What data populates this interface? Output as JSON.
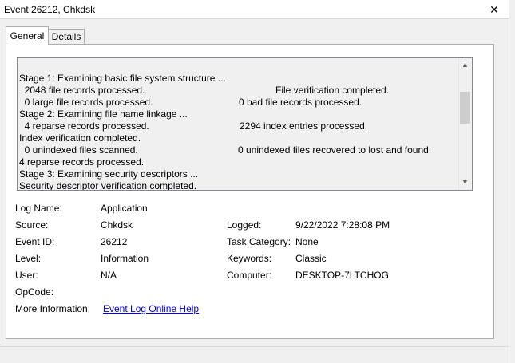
{
  "window": {
    "title": "Event 26212, Chkdsk",
    "close_glyph": "✕"
  },
  "tabs": [
    {
      "label": "General",
      "active": true
    },
    {
      "label": "Details",
      "active": false
    }
  ],
  "description_lines": [
    {
      "left": "Stage 1: Examining basic file system structure ...",
      "right": ""
    },
    {
      "left": "  2048 file records processed.",
      "right": "File verification completed."
    },
    {
      "left": "  0 large file records processed.",
      "right": "0 bad file records processed."
    },
    {
      "left": "Stage 2: Examining file name linkage ...",
      "right": ""
    },
    {
      "left": "  4 reparse records processed.",
      "right": "2294 index entries processed."
    },
    {
      "left": "Index verification completed.",
      "right": ""
    },
    {
      "left": "  0 unindexed files scanned.",
      "right": "0 unindexed files recovered to lost and found."
    },
    {
      "left": "4 reparse records processed.",
      "right": ""
    },
    {
      "left": "Stage 3: Examining security descriptors ...",
      "right": ""
    },
    {
      "left": "Security descriptor verification completed.",
      "right": ""
    }
  ],
  "fields": {
    "log_name": {
      "label": "Log Name:",
      "value": "Application"
    },
    "source": {
      "label": "Source:",
      "value": "Chkdsk"
    },
    "logged": {
      "label": "Logged:",
      "value": "9/22/2022 7:28:08 PM"
    },
    "event_id": {
      "label": "Event ID:",
      "value": "26212"
    },
    "task_category": {
      "label": "Task Category:",
      "value": "None"
    },
    "level": {
      "label": "Level:",
      "value": "Information"
    },
    "keywords": {
      "label": "Keywords:",
      "value": "Classic"
    },
    "user": {
      "label": "User:",
      "value": "N/A"
    },
    "computer": {
      "label": "Computer:",
      "value": "DESKTOP-7LTCHOG"
    },
    "opcode": {
      "label": "OpCode:",
      "value": ""
    },
    "more_info": {
      "label": "More Information:",
      "value": "Event Log Online Help"
    }
  },
  "icons": {
    "scroll_up": "▲",
    "scroll_down": "▼"
  },
  "colors": {
    "link": "#0000ee",
    "panel_bg": "#ffffff",
    "window_bg": "#f0f0f0"
  }
}
